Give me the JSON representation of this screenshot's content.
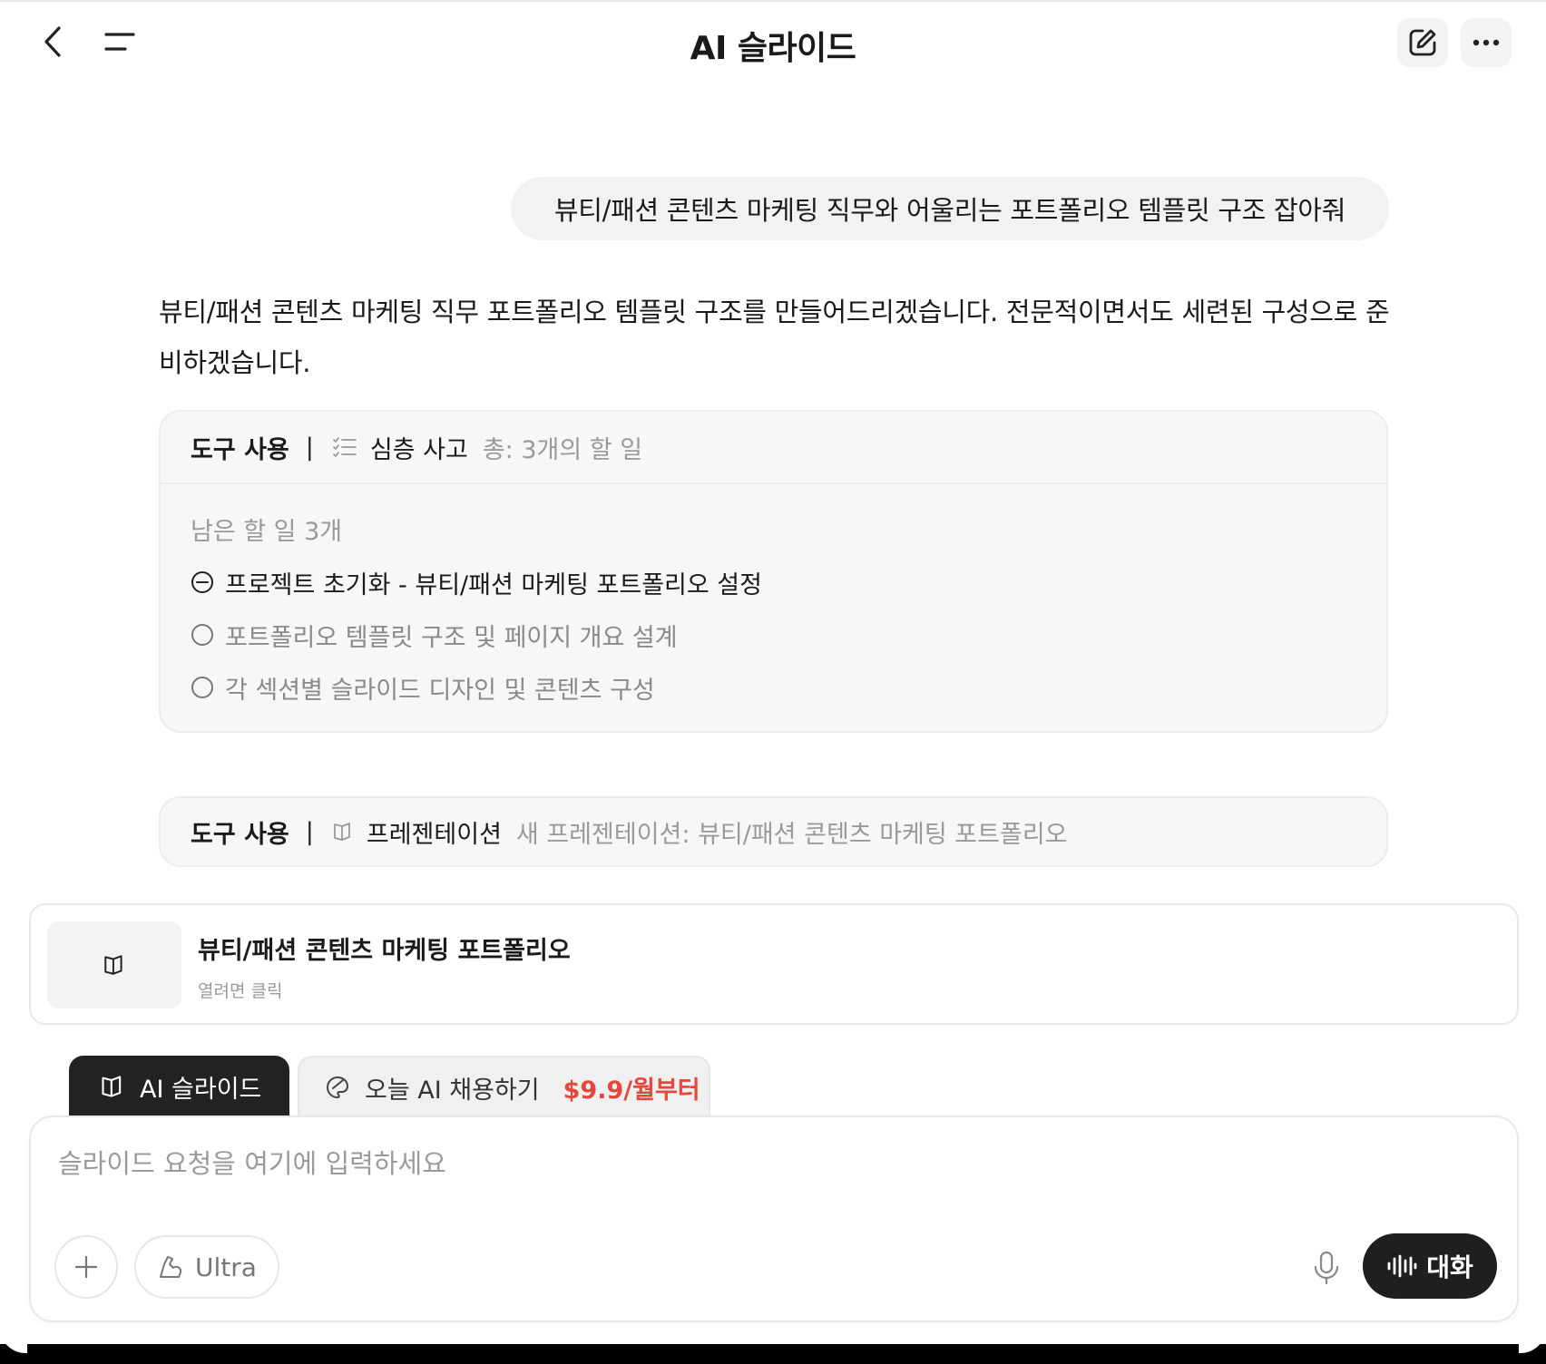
{
  "header": {
    "title": "AI 슬라이드",
    "icons": [
      "chevron-left-icon",
      "menu-icon",
      "edit-icon",
      "more-icon"
    ]
  },
  "chat": {
    "user_message": "뷰티/패션 콘텐츠 마케팅 직무와 어울리는 포트폴리오 템플릿 구조 잡아줘",
    "assistant_message": "뷰티/패션 콘텐츠 마케팅 직무 포트폴리오 템플릿 구조를 만들어드리겠습니다. 전문적이면서도 세련된 구성으로 준비하겠습니다."
  },
  "tool_use_1": {
    "label": "도구 사용",
    "separator": "|",
    "tool_name": "심층 사고",
    "meta": "총: 3개의 할 일",
    "remaining": "남은 할 일 3개",
    "tasks": [
      {
        "text": "프로젝트 초기화 - 뷰티/패션 마케팅 포트폴리오 설정",
        "status": "in-progress"
      },
      {
        "text": "포트폴리오 템플릿 구조 및 페이지 개요 설계",
        "status": "pending"
      },
      {
        "text": "각 섹션별 슬라이드 디자인 및 콘텐츠 구성",
        "status": "pending"
      }
    ]
  },
  "tool_use_2": {
    "label": "도구 사용",
    "separator": "|",
    "tool_name": "프레젠테이션",
    "meta": "새 프레젠테이션: 뷰티/패션 콘텐츠 마케팅 포트폴리오"
  },
  "file_card": {
    "title": "뷰티/패션 콘텐츠 마케팅 포트폴리오",
    "subtitle": "열려면 클릭"
  },
  "mode_tabs": {
    "active_label": "AI 슬라이드",
    "promo_label": "오늘 AI 채용하기",
    "promo_price": "$9.9/월부터"
  },
  "composer": {
    "placeholder": "슬라이드 요청을 여기에 입력하세요",
    "value": "",
    "ultra_label": "Ultra",
    "talk_label": "대화"
  },
  "colors": {
    "accent_price": "#e5483b",
    "dark_button": "#1f1f1f",
    "card_bg": "#f7f7f7"
  }
}
